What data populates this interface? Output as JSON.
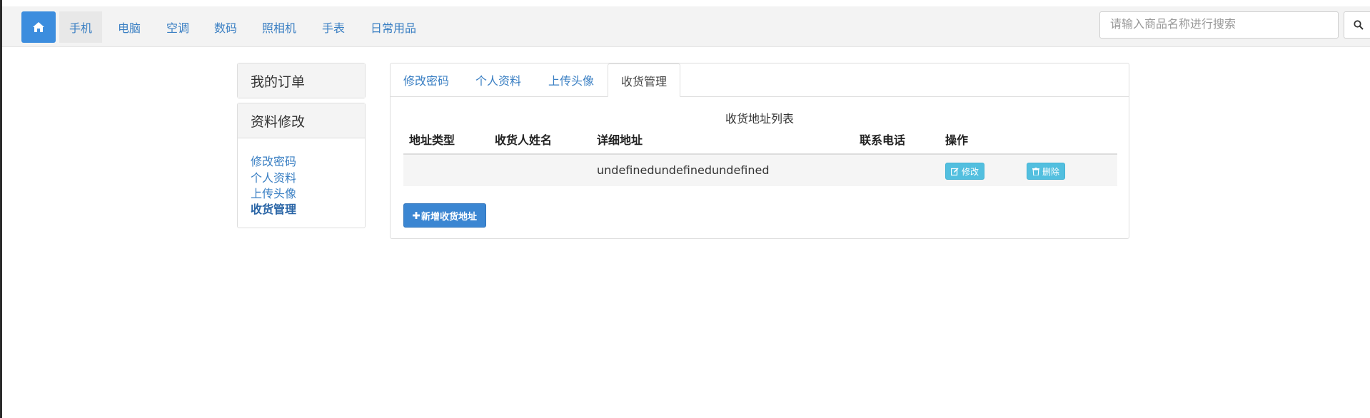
{
  "navbar": {
    "home_icon": "home-icon",
    "categories": [
      {
        "label": "手机",
        "active": true
      },
      {
        "label": "电脑",
        "active": false
      },
      {
        "label": "空调",
        "active": false
      },
      {
        "label": "数码",
        "active": false
      },
      {
        "label": "照相机",
        "active": false
      },
      {
        "label": "手表",
        "active": false
      },
      {
        "label": "日常用品",
        "active": false
      }
    ],
    "search": {
      "placeholder": "请输入商品名称进行搜索",
      "value": ""
    },
    "search_icon": "search-icon"
  },
  "sidebar": {
    "orders_title": "我的订单",
    "profile_title": "资料修改",
    "links": [
      {
        "label": "修改密码",
        "current": false
      },
      {
        "label": "个人资料",
        "current": false
      },
      {
        "label": "上传头像",
        "current": false
      },
      {
        "label": "收货管理",
        "current": true
      }
    ]
  },
  "main": {
    "tabs": [
      {
        "label": "修改密码",
        "active": false
      },
      {
        "label": "个人资料",
        "active": false
      },
      {
        "label": "上传头像",
        "active": false
      },
      {
        "label": "收货管理",
        "active": true
      }
    ],
    "table": {
      "caption": "收货地址列表",
      "headers": [
        "地址类型",
        "收货人姓名",
        "详细地址",
        "联系电话",
        "操作"
      ],
      "rows": [
        {
          "type": "",
          "name": "",
          "address": "undefinedundefinedundefined",
          "phone": "",
          "edit_label": "修改",
          "delete_label": "删除"
        }
      ]
    },
    "add_button_label": "新增收货地址"
  },
  "colors": {
    "primary": "#3c8dde",
    "link": "#3a7fc3",
    "info": "#52bfdf",
    "navbar_bg": "#f3f3f3"
  }
}
